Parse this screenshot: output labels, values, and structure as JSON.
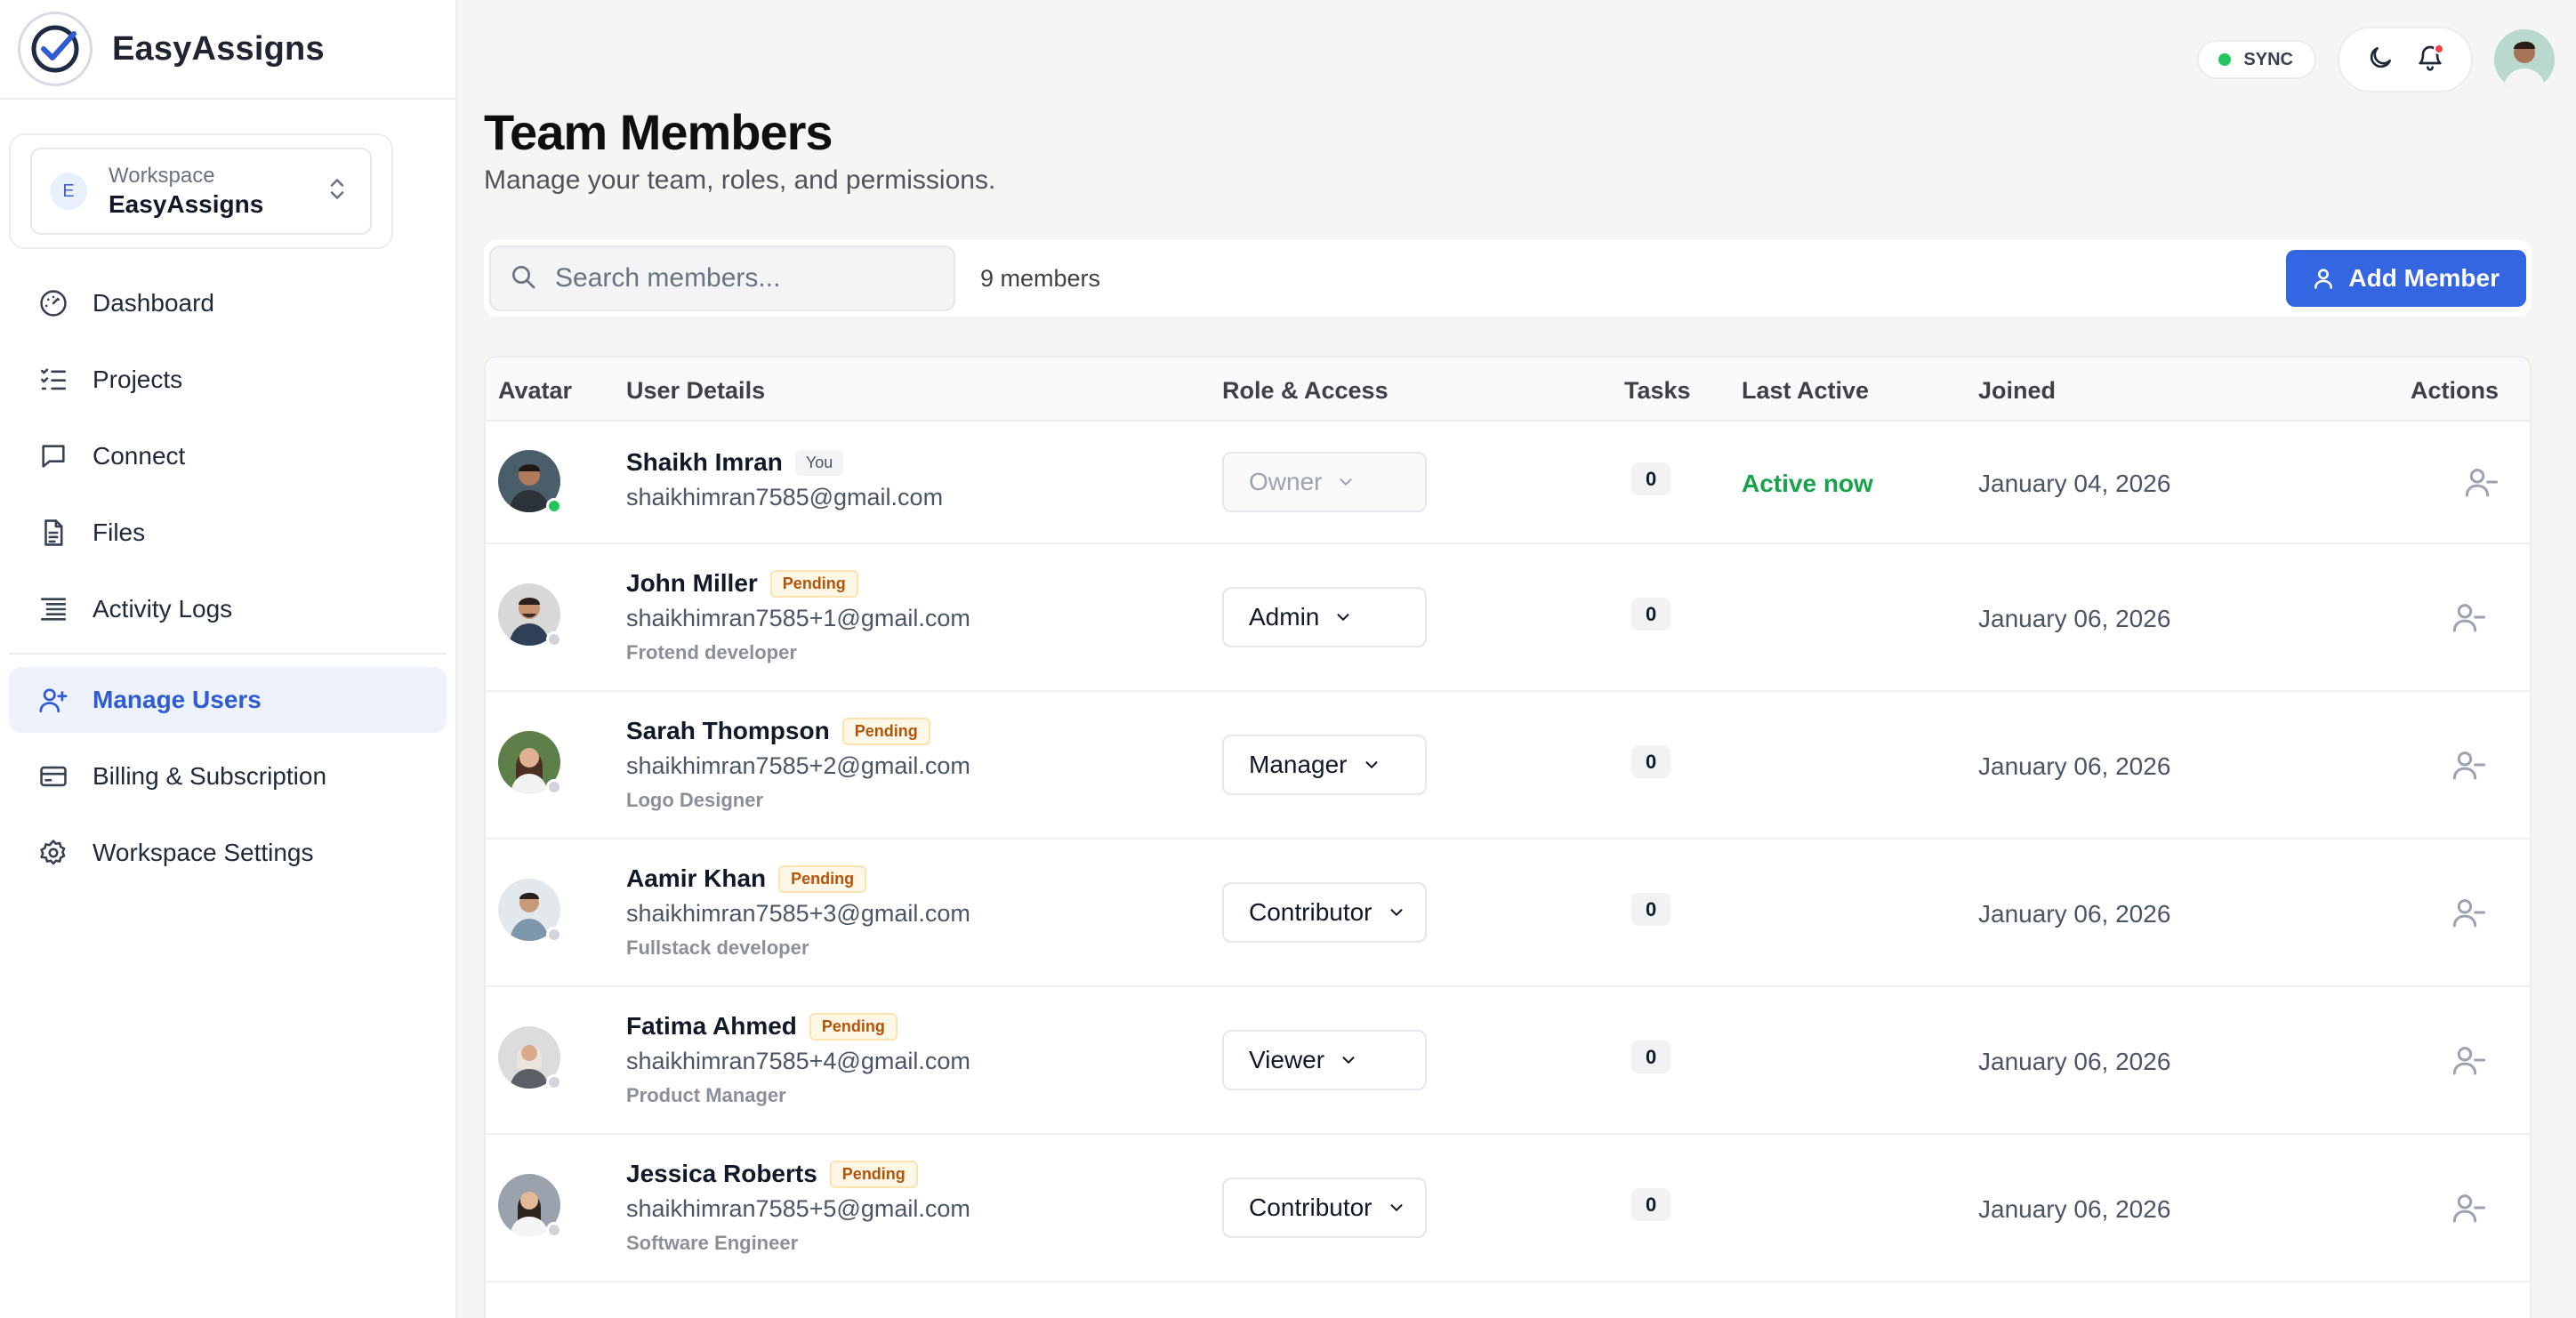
{
  "brand": {
    "name": "EasyAssigns"
  },
  "workspace": {
    "badge": "E",
    "label": "Workspace",
    "name": "EasyAssigns"
  },
  "nav": [
    {
      "label": "Dashboard",
      "icon": "dashboard-gauge-icon"
    },
    {
      "label": "Projects",
      "icon": "list-checks-icon"
    },
    {
      "label": "Connect",
      "icon": "chat-bubble-icon"
    },
    {
      "label": "Files",
      "icon": "file-icon"
    },
    {
      "label": "Activity Logs",
      "icon": "activity-list-icon"
    },
    {
      "label": "Manage Users",
      "icon": "user-plus-icon",
      "active": true
    },
    {
      "label": "Billing & Subscription",
      "icon": "credit-card-icon"
    },
    {
      "label": "Workspace Settings",
      "icon": "gear-icon"
    }
  ],
  "topbar": {
    "sync_label": "SYNC",
    "sync_color": "#22c55e",
    "notification_color": "#ef4444"
  },
  "page": {
    "title": "Team Members",
    "subtitle": "Manage your team, roles, and permissions."
  },
  "toolbar": {
    "search_placeholder": "Search members...",
    "count": "9 members",
    "add_label": "Add Member",
    "accent": "#3366e0"
  },
  "table": {
    "headers": {
      "avatar": "Avatar",
      "user": "User Details",
      "role": "Role & Access",
      "tasks": "Tasks",
      "last": "Last Active",
      "joined": "Joined",
      "actions": "Actions"
    },
    "rows": [
      {
        "name": "Shaikh Imran",
        "tag": "You",
        "email": "shaikhimran7585@gmail.com",
        "job": "",
        "role": "Owner",
        "tasks": "0",
        "last_active": "Active now",
        "joined": "January 04, 2026",
        "online": true
      },
      {
        "name": "John Miller",
        "tag": "Pending",
        "email": "shaikhimran7585+1@gmail.com",
        "job": "Frotend developer",
        "role": "Admin",
        "tasks": "0",
        "last_active": "",
        "joined": "January 06, 2026",
        "online": false
      },
      {
        "name": "Sarah Thompson",
        "tag": "Pending",
        "email": "shaikhimran7585+2@gmail.com",
        "job": "Logo Designer",
        "role": "Manager",
        "tasks": "0",
        "last_active": "",
        "joined": "January 06, 2026",
        "online": false
      },
      {
        "name": "Aamir Khan",
        "tag": "Pending",
        "email": "shaikhimran7585+3@gmail.com",
        "job": "Fullstack developer",
        "role": "Contributor",
        "tasks": "0",
        "last_active": "",
        "joined": "January 06, 2026",
        "online": false
      },
      {
        "name": "Fatima Ahmed",
        "tag": "Pending",
        "email": "shaikhimran7585+4@gmail.com",
        "job": "Product Manager",
        "role": "Viewer",
        "tasks": "0",
        "last_active": "",
        "joined": "January 06, 2026",
        "online": false
      },
      {
        "name": "Jessica Roberts",
        "tag": "Pending",
        "email": "shaikhimran7585+5@gmail.com",
        "job": "Software Engineer",
        "role": "Contributor",
        "tasks": "0",
        "last_active": "",
        "joined": "January 06, 2026",
        "online": false
      }
    ]
  }
}
